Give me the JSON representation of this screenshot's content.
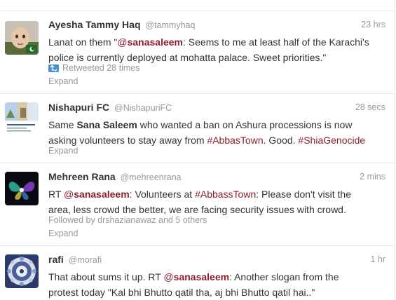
{
  "colors": {
    "link": "#8a1f2a",
    "meta": "#999999",
    "text": "#333333",
    "border": "#e8e8e8"
  },
  "tweets": [
    {
      "fullname": "Ayesha Tammy Haq",
      "screen_name": "@tammyhaq",
      "time": "23 hrs",
      "text_pre": "Lanat on them \"",
      "mention_at": "@",
      "mention_name": "sanasaleem",
      "line1_rest": ": Seems to me at least half of the Karachi's",
      "line2": "police is currently deployed at mohatta palace. Sweet priorities.\"",
      "retweet_icon": "retweet-icon",
      "retweeted": "Retweeted 28 times",
      "expand": "Expand"
    },
    {
      "fullname": "Nishapuri FC",
      "screen_name": "@NishapuriFC",
      "time": "28 secs",
      "line1_pre": "Same ",
      "line1_bold": "Sana Saleem",
      "line1_rest": " who wanted a ban on Ashura processions is now",
      "line2_pre": "asking volunteers to stay away from ",
      "hashtag1": "#AbbasTown",
      "line2_mid": ". Good. ",
      "hashtag2": "#ShiaGenocide",
      "expand": "Expand"
    },
    {
      "fullname": "Mehreen Rana",
      "screen_name": "@mehreenrana",
      "time": "2 mins",
      "line1_pre": "RT ",
      "mention_at": "@",
      "mention_name": "sanasaleem",
      "line1_mid": ": Volunteers at ",
      "hashtag": "#AbbassTown",
      "line1_rest": ": Please don't visit the",
      "line2": "area, less crowd the better, we are facing security issues with crowd.",
      "followed": "Followed by drshazianawaz and 5 others",
      "expand": "Expand"
    },
    {
      "fullname": "rafi",
      "screen_name": "@morafi",
      "time": "1 hr",
      "line1_pre": "That about sums it up. RT ",
      "mention_at": "@",
      "mention_name": "sanasaleem",
      "line1_rest": ": Another slogan from the",
      "line2": "protest today \"Kal bhi Bhutto qatil tha, aj bhi Bhutto qatil hai..\""
    }
  ]
}
